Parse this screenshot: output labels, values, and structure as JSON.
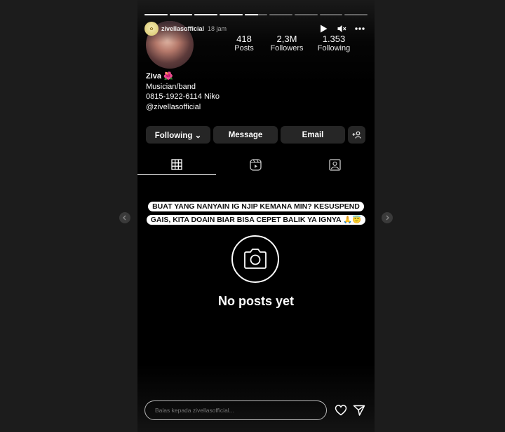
{
  "story": {
    "progress_segments": [
      1,
      1,
      1,
      1,
      0.6,
      0,
      0,
      0,
      0
    ],
    "username": "zivellasofficial",
    "time": "18 jam",
    "controls": {
      "play_icon": "play-icon",
      "mute_icon": "mute-icon",
      "more_icon": "more-icon"
    }
  },
  "profile": {
    "stats": [
      {
        "value": "418",
        "label": "Posts"
      },
      {
        "value": "2,3M",
        "label": "Followers"
      },
      {
        "value": "1.353",
        "label": "Following"
      }
    ],
    "name": "Ziva 🌺",
    "category": "Musician/band",
    "contact": "0815-1922-6114 Niko",
    "handle": "@zivellasofficial",
    "buttons": {
      "following": "Following ⌄",
      "message": "Message",
      "email": "Email"
    }
  },
  "tabs": [
    {
      "icon": "grid-icon",
      "active": true
    },
    {
      "icon": "reels-icon",
      "active": false
    },
    {
      "icon": "tagged-icon",
      "active": false
    }
  ],
  "caption": {
    "line1": "BUAT YANG NANYAIN IG NJIP KEMANA MIN? KESUSPEND",
    "line2": "GAIS, KITA DOAIN BIAR BISA CEPET BALIK YA IGNYA 🙏😇"
  },
  "empty_state": {
    "text": "No posts yet"
  },
  "reply": {
    "placeholder": "Balas kepada zivellasofficial..."
  }
}
